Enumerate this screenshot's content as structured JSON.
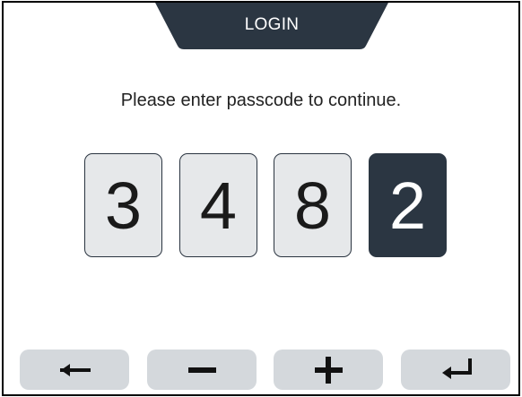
{
  "title": "LOGIN",
  "prompt": "Please enter passcode to continue.",
  "passcode": {
    "digits": [
      "3",
      "4",
      "8",
      "2"
    ],
    "active_index": 3
  },
  "keys": [
    {
      "name": "back",
      "icon": "arrow-left-icon"
    },
    {
      "name": "decrement",
      "icon": "minus-icon"
    },
    {
      "name": "increment",
      "icon": "plus-icon"
    },
    {
      "name": "enter",
      "icon": "enter-return-icon"
    }
  ],
  "colors": {
    "header": "#2b3642",
    "digit_bg": "#e6e8ea",
    "digit_active_bg": "#2b3642",
    "key_bg": "#d4d8dc"
  }
}
